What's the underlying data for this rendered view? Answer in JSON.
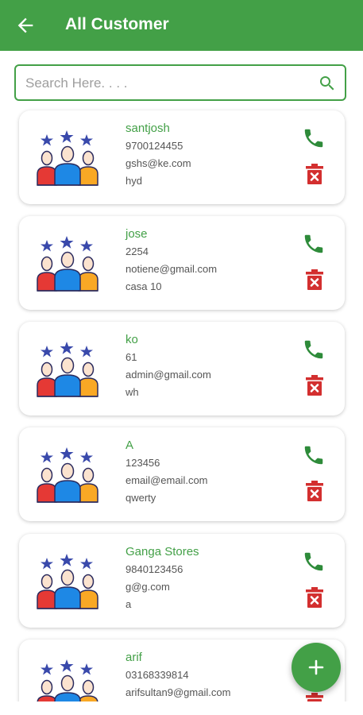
{
  "appbar": {
    "title": "All Customer",
    "back_icon": "arrow-back-icon",
    "color": "#43a047"
  },
  "search": {
    "placeholder": "Search Here. . . .",
    "value": "",
    "icon": "search-icon"
  },
  "customers": [
    {
      "name": "santjosh",
      "phone": "9700124455",
      "email": "gshs@ke.com",
      "address": "hyd"
    },
    {
      "name": "jose",
      "phone": "2254",
      "email": "notiene@gmail.com",
      "address": "casa 10"
    },
    {
      "name": "ko",
      "phone": "61",
      "email": "admin@gmail.com",
      "address": "wh"
    },
    {
      "name": "A",
      "phone": "123456",
      "email": "email@email.com",
      "address": "qwerty"
    },
    {
      "name": "Ganga Stores",
      "phone": "9840123456",
      "email": "g@g.com",
      "address": "a"
    },
    {
      "name": "arif",
      "phone": "03168339814",
      "email": "arifsultan9@gmail.com",
      "address": ""
    }
  ],
  "colors": {
    "primary": "#43a047",
    "call": "#2e8b3a",
    "delete": "#d32f2f"
  },
  "fab": {
    "icon": "add-icon"
  }
}
